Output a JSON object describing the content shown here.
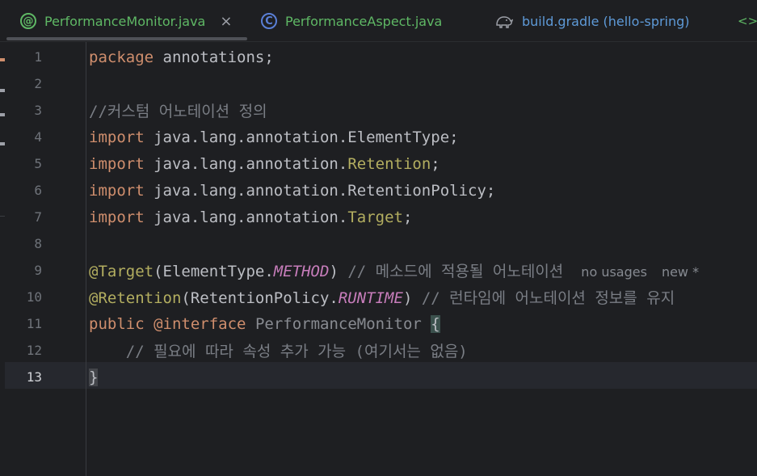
{
  "tabs": [
    {
      "label": "PerformanceMonitor.java",
      "icon": "annotation-icon",
      "icon_glyph": "@",
      "active": true,
      "close_glyph": "×"
    },
    {
      "label": "PerformanceAspect.java",
      "icon": "class-icon",
      "icon_glyph": "C"
    },
    {
      "label": "build.gradle (hello-spring)",
      "icon": "gradle-elephant-icon"
    },
    {
      "label": "<>",
      "icon": "more-tabs-icon"
    }
  ],
  "editor": {
    "current_line": 13,
    "lines": [
      {
        "n": "1"
      },
      {
        "n": "2"
      },
      {
        "n": "3"
      },
      {
        "n": "4"
      },
      {
        "n": "5"
      },
      {
        "n": "6"
      },
      {
        "n": "7"
      },
      {
        "n": "8"
      },
      {
        "n": "9"
      },
      {
        "n": "10"
      },
      {
        "n": "11"
      },
      {
        "n": "12"
      },
      {
        "n": "13"
      }
    ],
    "tokens": {
      "l1_kw": "package",
      "l1_rest": " annotations;",
      "l3_comment": "//커스텀 어노테이션 정의",
      "import_kw": "import",
      "l4_rest": " java.lang.annotation.ElementType;",
      "l5_pkg": " java.lang.annotation.",
      "l5_ann": "Retention",
      "l5_end": ";",
      "l6_rest": " java.lang.annotation.RetentionPolicy;",
      "l7_pkg": " java.lang.annotation.",
      "l7_ann": "Target",
      "l7_end": ";",
      "l9_ann": "@Target",
      "l9_open": "(ElementType.",
      "l9_const": "METHOD",
      "l9_close": ")",
      "l9_comment": " // 메소드에 적용될 어노테이션",
      "l9_hint1": "no usages",
      "l9_hint2": "new *",
      "l10_ann": "@Retention",
      "l10_open": "(RetentionPolicy.",
      "l10_const": "RUNTIME",
      "l10_close": ")",
      "l10_comment": " // 런타임에 어노테이션 정보를 유지",
      "l11_kw1": "public",
      "l11_kw2": "@interface",
      "l11_name": "PerformanceMonitor",
      "l11_brace": "{",
      "l12_comment": "    // 필요에 따라 속성 추가 가능 (여기서는 없음)",
      "l13_brace": "}"
    }
  },
  "colors": {
    "background": "#1e1f22",
    "keyword": "#cf8e6d",
    "annotation": "#b3ae60",
    "constant": "#c77dbb",
    "comment": "#7a7e85",
    "tab_active_text": "#5fb865"
  }
}
